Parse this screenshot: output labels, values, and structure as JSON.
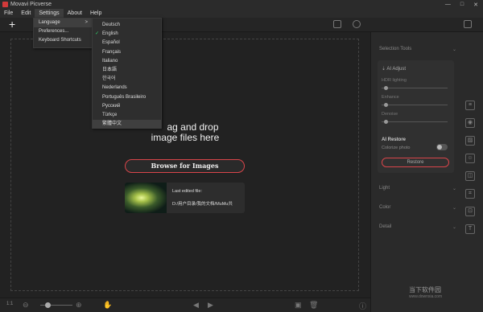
{
  "window": {
    "title": "Movavi Picverse",
    "controls": [
      "—",
      "□",
      "✕"
    ]
  },
  "menubar": [
    {
      "label": "File"
    },
    {
      "label": "Edit"
    },
    {
      "label": "Settings"
    },
    {
      "label": "About"
    },
    {
      "label": "Help"
    }
  ],
  "settings_menu": {
    "items": [
      {
        "label": "Language",
        "submenu_arrow": ">"
      },
      {
        "label": "Preferences..."
      },
      {
        "label": "Keyboard Shortcuts"
      }
    ]
  },
  "language_menu": {
    "selected": "English",
    "items": [
      {
        "label": "Deutsch"
      },
      {
        "label": "English",
        "check": "✓"
      },
      {
        "label": "Español"
      },
      {
        "label": "Français"
      },
      {
        "label": "Italiano"
      },
      {
        "label": "日本語"
      },
      {
        "label": "한국어"
      },
      {
        "label": "Nederlands"
      },
      {
        "label": "Português Brasileiro"
      },
      {
        "label": "Русский"
      },
      {
        "label": "Türkçe"
      },
      {
        "label": "繁體中文"
      }
    ]
  },
  "toolbar": {
    "add_glyph": "+"
  },
  "dropzone": {
    "line1": "ag and drop",
    "line2": "image files here",
    "browse_label": "Browse for Images"
  },
  "last_edited": {
    "label": "Last edited file:",
    "path": "D:/用户目录/我的文档/MuMu共"
  },
  "statusbar": {
    "zoom_text": "1:1"
  },
  "right_panel": {
    "selection_tools": "Selection Tools",
    "ai_adjust": "AI Adjust",
    "hdr_lighting": "HDR lighting",
    "enhance": "Enhance",
    "denoise": "Denoise",
    "ai_restore": "AI Restore",
    "colorize_photo": "Colorize photo",
    "restore_button": "Restore",
    "light": "Light",
    "color": "Color",
    "detail": "Detail"
  },
  "watermark": {
    "title": "当下软件园",
    "url": "www.downxia.com"
  }
}
